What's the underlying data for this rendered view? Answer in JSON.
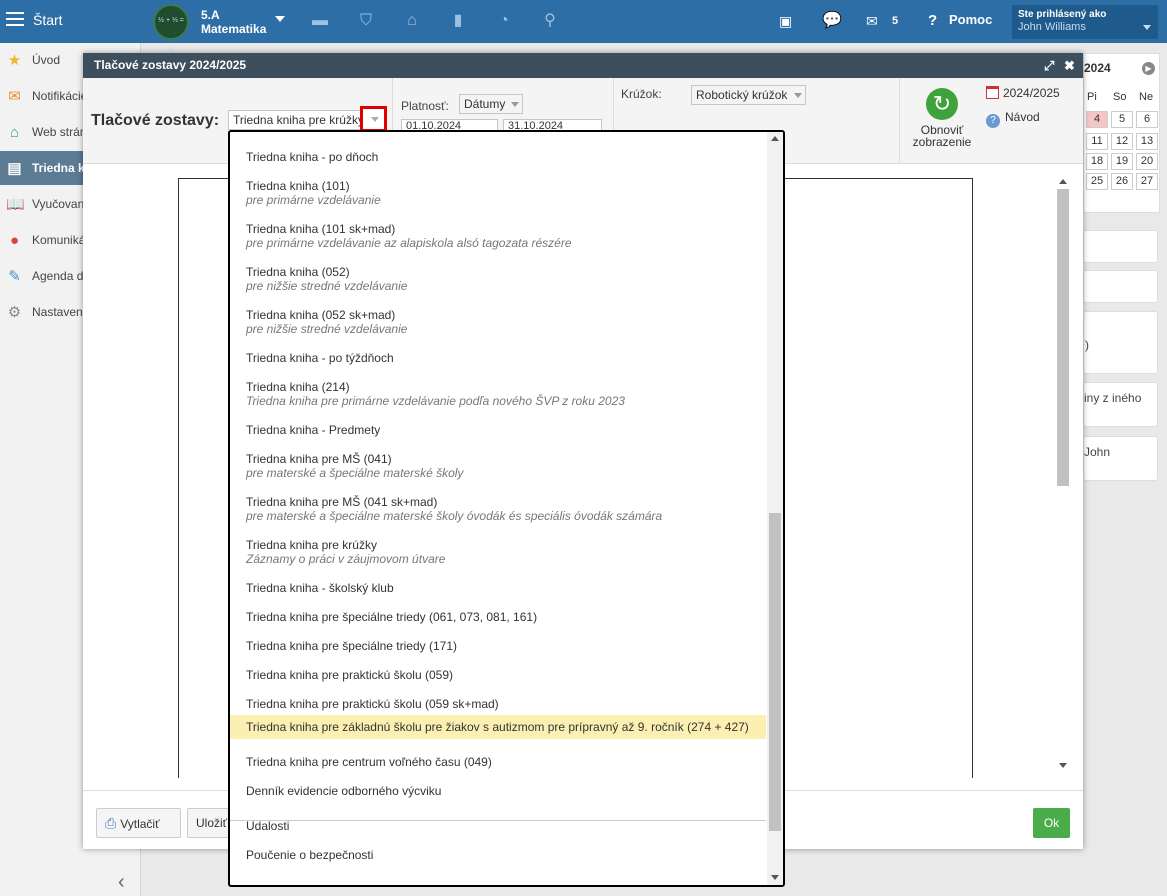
{
  "topbar": {
    "start_label": "Štart",
    "class_avatar_text": "½ + ⅓ = ⅚",
    "class_code": "5.A",
    "class_subject": "Matematika",
    "message_count": "5",
    "help_label": "Pomoc",
    "user_caption": "Ste prihlásený ako",
    "user_name": "John Williams"
  },
  "sidebar": {
    "items": [
      {
        "label": "Úvod"
      },
      {
        "label": "Notifikácie"
      },
      {
        "label": "Web stránka"
      },
      {
        "label": "Triedna kniha"
      },
      {
        "label": "Vyučovanie"
      },
      {
        "label": "Komunikácia"
      },
      {
        "label": "Agenda dochádzky"
      },
      {
        "label": "Nastavenia"
      }
    ],
    "collapse_symbol": "‹"
  },
  "calendar": {
    "year": "2024",
    "day_headers": [
      "Pi",
      "So",
      "Ne"
    ],
    "rows": [
      [
        "4",
        "5",
        "6"
      ],
      [
        "11",
        "12",
        "13"
      ],
      [
        "18",
        "19",
        "20"
      ],
      [
        "25",
        "26",
        "27"
      ]
    ]
  },
  "right_cards": {
    "card3_text": ")",
    "card4_text": "iny z iného",
    "card5_text": "John"
  },
  "dialog": {
    "title": "Tlačové zostavy 2024/2025",
    "reports_label": "Tlačové zostavy:",
    "reports_selected": "Triedna kniha pre krúžky",
    "validity_label": "Platnosť:",
    "validity_mode": "Dátumy",
    "date_from": "01.10.2024",
    "date_to": "31.10.2024",
    "club_label": "Krúžok:",
    "club_selected": "Robotický krúžok",
    "refresh_label_1": "Obnoviť",
    "refresh_label_2": "zobrazenie",
    "school_year": "2024/2025",
    "guide_label": "Návod",
    "print_button": "Vytlačiť",
    "save_button": "Uložiť",
    "ok_button": "Ok"
  },
  "dropdown": {
    "items": [
      {
        "title": "Triedna kniha - po dňoch",
        "sub": ""
      },
      {
        "title": "Triedna kniha (101)",
        "sub": "pre primárne vzdelávanie"
      },
      {
        "title": "Triedna kniha (101 sk+mad)",
        "sub": "pre primárne vzdelávanie az alapiskola alsó tagozata részére"
      },
      {
        "title": "Triedna kniha (052)",
        "sub": "pre nižšie stredné vzdelávanie"
      },
      {
        "title": "Triedna kniha (052 sk+mad)",
        "sub": "pre nižšie stredné vzdelávanie"
      },
      {
        "title": "Triedna kniha - po týždňoch",
        "sub": ""
      },
      {
        "title": "Triedna kniha (214)",
        "sub": "Triedna kniha pre primárne vzdelávanie podľa nového ŠVP z roku 2023"
      },
      {
        "title": "Triedna kniha - Predmety",
        "sub": ""
      },
      {
        "title": "Triedna kniha pre MŠ (041)",
        "sub": "pre materské a špeciálne materské školy"
      },
      {
        "title": "Triedna kniha pre MŠ (041 sk+mad)",
        "sub": "pre materské a špeciálne materské školy óvodák és speciális óvodák számára"
      },
      {
        "title": "Triedna kniha pre krúžky",
        "sub": "Záznamy o práci v záujmovom útvare"
      },
      {
        "title": "Triedna kniha - školský klub",
        "sub": ""
      },
      {
        "title": "Triedna kniha pre špeciálne triedy (061, 073, 081, 161)",
        "sub": ""
      },
      {
        "title": "Triedna kniha pre špeciálne triedy (171)",
        "sub": ""
      },
      {
        "title": "Triedna kniha pre praktickú školu (059)",
        "sub": ""
      },
      {
        "title": "Triedna kniha pre praktickú školu (059 sk+mad)",
        "sub": ""
      },
      {
        "title": "Triedna kniha pre základnú školu pre žiakov s autizmom pre prípravný až 9. ročník (274 + 427)",
        "sub": "",
        "highlighted": true
      },
      {
        "title": "Triedna kniha pre centrum voľného času (049)",
        "sub": ""
      },
      {
        "title": "Denník evidencie odborného výcviku",
        "sub": ""
      },
      {
        "title": "Udalosti",
        "sub": "",
        "separator_before": true
      },
      {
        "title": "Poučenie o bezpečnosti",
        "sub": ""
      }
    ]
  },
  "colors": {
    "topbar": "#2c6ea5",
    "dialog_title": "#3d4e5c",
    "highlight_row": "#fbf0b2",
    "ok_button": "#4aad49",
    "focus_outline": "#e00000"
  }
}
